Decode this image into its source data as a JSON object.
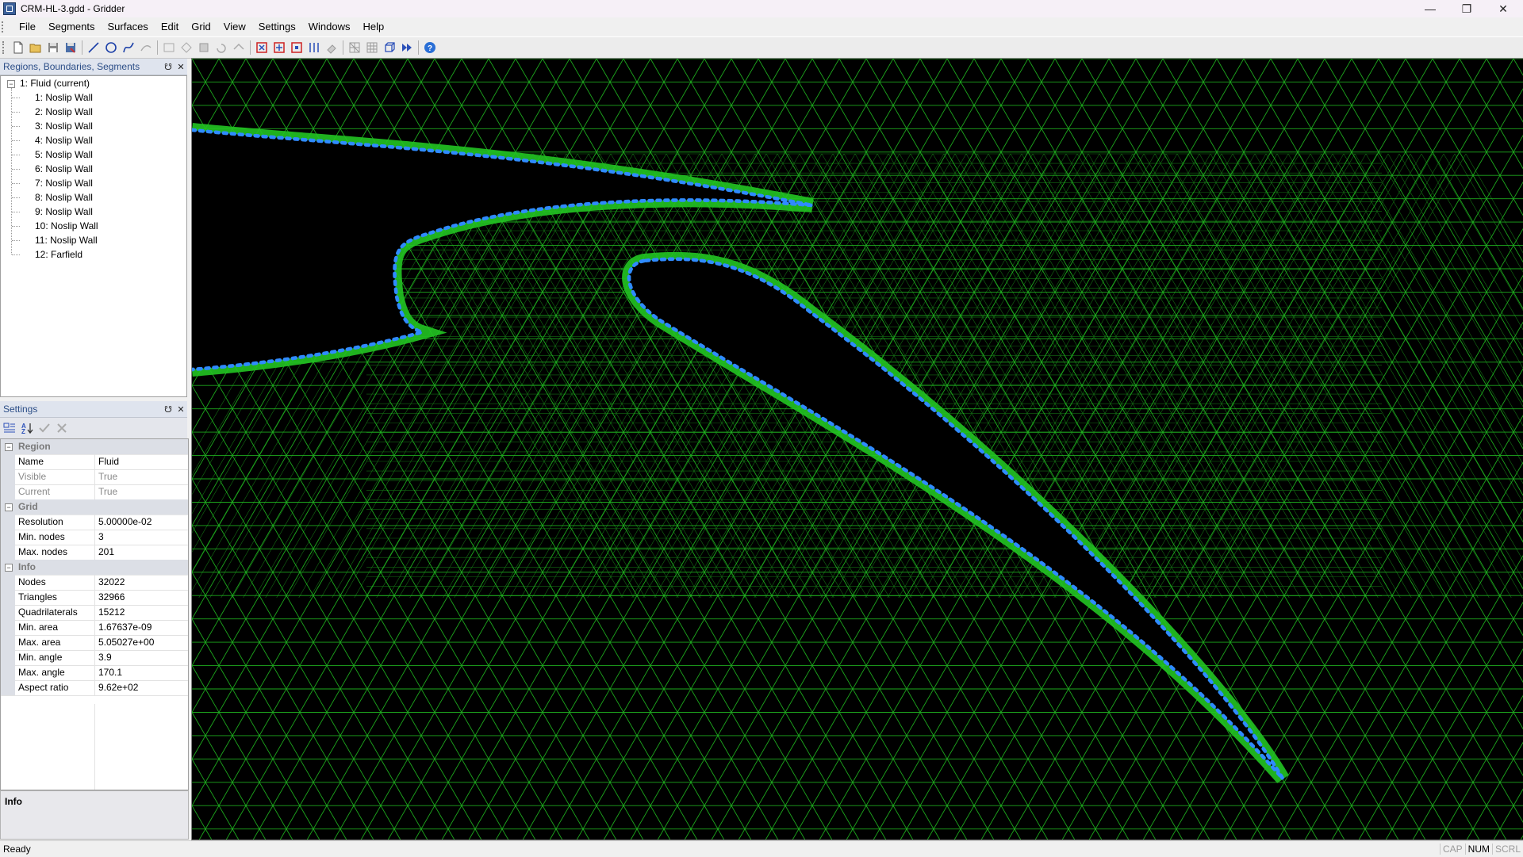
{
  "window": {
    "title": "CRM-HL-3.gdd - Gridder"
  },
  "menu": [
    "File",
    "Segments",
    "Surfaces",
    "Edit",
    "Grid",
    "View",
    "Settings",
    "Windows",
    "Help"
  ],
  "toolbar": {
    "icons": [
      "new-file-icon",
      "open-icon",
      "save-icon",
      "save-as-icon",
      "line-icon",
      "circle-icon",
      "spline-icon",
      "arc-icon",
      "rectangle-icon",
      "rotate-icon",
      "scale-icon",
      "undo-icon",
      "redo-icon",
      "delete-points-icon",
      "insert-points-icon",
      "move-points-icon",
      "distribute-icon",
      "eraser-icon",
      "grid-icon",
      "grid-quad-icon",
      "cube-icon",
      "generate-icon",
      "help-icon"
    ]
  },
  "regions_panel": {
    "title": "Regions, Boundaries, Segments",
    "root": "1: Fluid (current)",
    "children": [
      "1: Noslip Wall",
      "2: Noslip Wall",
      "3: Noslip Wall",
      "4: Noslip Wall",
      "5: Noslip Wall",
      "6: Noslip Wall",
      "7: Noslip Wall",
      "8: Noslip Wall",
      "9: Noslip Wall",
      "10: Noslip Wall",
      "11: Noslip Wall",
      "12: Farfield"
    ]
  },
  "settings_panel": {
    "title": "Settings",
    "region": {
      "label": "Region",
      "props": [
        {
          "name": "Name",
          "value": "Fluid",
          "disabled": false
        },
        {
          "name": "Visible",
          "value": "True",
          "disabled": true
        },
        {
          "name": "Current",
          "value": "True",
          "disabled": true
        }
      ]
    },
    "grid": {
      "label": "Grid",
      "props": [
        {
          "name": "Resolution",
          "value": "5.00000e-02"
        },
        {
          "name": "Min. nodes",
          "value": "3"
        },
        {
          "name": "Max. nodes",
          "value": "201"
        }
      ]
    },
    "info": {
      "label": "Info",
      "props": [
        {
          "name": "Nodes",
          "value": "32022"
        },
        {
          "name": "Triangles",
          "value": "32966"
        },
        {
          "name": "Quadrilaterals",
          "value": "15212"
        },
        {
          "name": "Min. area",
          "value": "1.67637e-09"
        },
        {
          "name": "Max. area",
          "value": "5.05027e+00"
        },
        {
          "name": "Min. angle",
          "value": "3.9"
        },
        {
          "name": "Max. angle",
          "value": "170.1"
        },
        {
          "name": "Aspect ratio",
          "value": "9.62e+02"
        }
      ]
    },
    "description_title": "Info"
  },
  "status": {
    "text": "Ready",
    "indicators": [
      "CAP",
      "NUM",
      "SCRL"
    ],
    "active": [
      "NUM"
    ]
  },
  "colors": {
    "mesh": "#22c422",
    "wall_nodes": "#2f8bff",
    "background": "#000000"
  }
}
